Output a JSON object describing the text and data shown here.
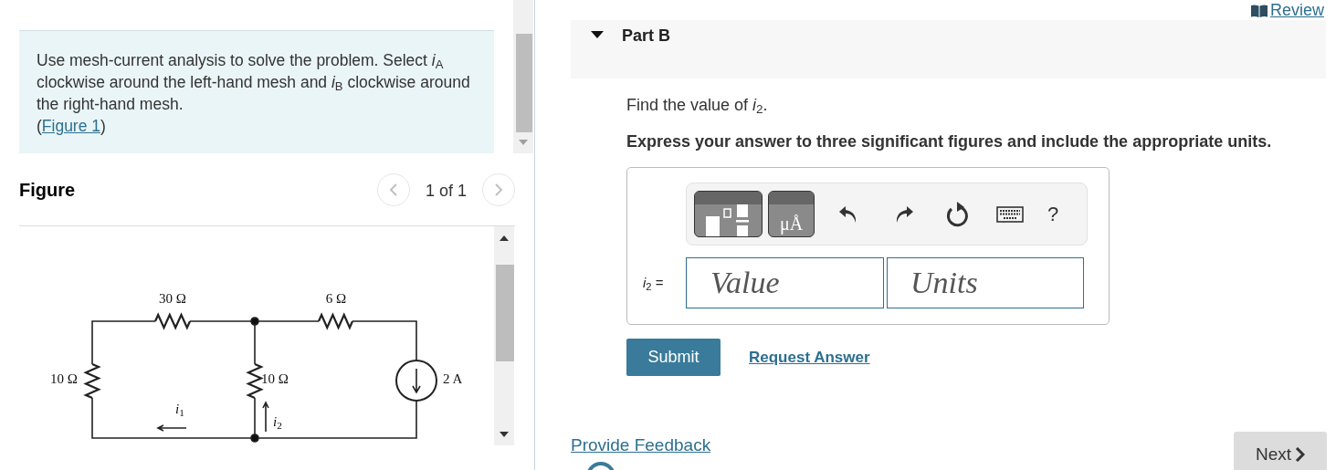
{
  "instructions": {
    "text": "Use mesh-current analysis to solve the problem. Select *i*$_{A}$ clockwise around the left-hand mesh and *i*$_{B}$ clockwise around the right-hand mesh.",
    "ref_open": "(",
    "ref_link": "Figure 1",
    "ref_close": ")"
  },
  "figure": {
    "title": "Figure",
    "pager": "1 of 1",
    "labels": [
      {
        "text": "30 Ω"
      },
      {
        "text": "6 Ω"
      },
      {
        "text": "10 Ω"
      },
      {
        "text": "10 Ω"
      },
      {
        "text": "2 A"
      },
      {
        "text": "*i*$_{1}$"
      },
      {
        "text": "*i*$_{2}$"
      }
    ]
  },
  "review_link": "Review",
  "part": {
    "title": "Part B",
    "expanded": true,
    "prompt": "Find the value of *i*$_{2}$.",
    "instruction": "Express your answer to three significant figures and include the appropriate units.",
    "toolbar": {
      "units_key": "μÅ",
      "help": "?"
    },
    "answer": {
      "label": "*i*$_{2}$ =",
      "value_placeholder": "Value",
      "units_placeholder": "Units"
    },
    "submit": "Submit",
    "request_answer": "Request Answer"
  },
  "feedback_link": "Provide Feedback",
  "next_button": "Next"
}
